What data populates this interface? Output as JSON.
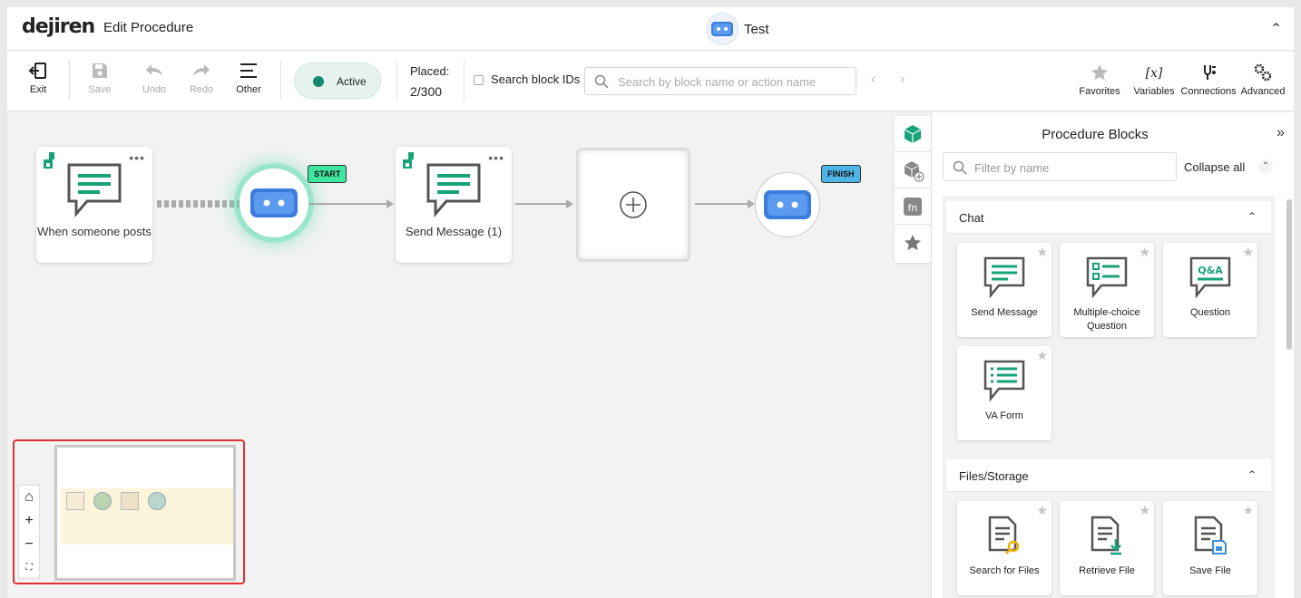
{
  "header": {
    "logo": "dejiren",
    "page_title": "Edit Procedure",
    "bot_name": "Test",
    "collapse_glyph": "⌃"
  },
  "toolbar": {
    "exit": "Exit",
    "save": "Save",
    "undo": "Undo",
    "redo": "Redo",
    "other": "Other",
    "status": "Active",
    "placed_label": "Placed:",
    "placed_value": "2/300",
    "search_ids_label": "Search block IDs",
    "search_placeholder": "Search by block name or action name",
    "favorites": "Favorites",
    "variables": "Variables",
    "connections": "Connections",
    "advanced": "Advanced"
  },
  "canvas": {
    "trigger_block": "When someone posts",
    "message_block": "Send Message (1)",
    "start_tag": "START",
    "finish_tag": "FINISH",
    "more_glyph": "•••"
  },
  "minimap": {
    "home_glyph": "⌂",
    "zoom_in": "+",
    "zoom_out": "−",
    "fit_glyph": "⛶"
  },
  "panel": {
    "title": "Procedure Blocks",
    "close_glyph": "»",
    "filter_placeholder": "Filter by name",
    "collapse_all": "Collapse all",
    "categories": [
      {
        "name": "Chat",
        "chevron": "⌃",
        "blocks": [
          "Send Message",
          "Multiple-choice Question",
          "Question",
          "VA Form"
        ]
      },
      {
        "name": "Files/Storage",
        "chevron": "⌃",
        "blocks": [
          "Search for Files",
          "Retrieve File",
          "Save File"
        ]
      }
    ]
  },
  "colors": {
    "accent_green": "#14896c",
    "start_tag": "#3ee6a0",
    "finish_tag": "#4fb4e6",
    "bot_blue": "#3b7ddd",
    "minimap_highlight": "#e03030"
  }
}
